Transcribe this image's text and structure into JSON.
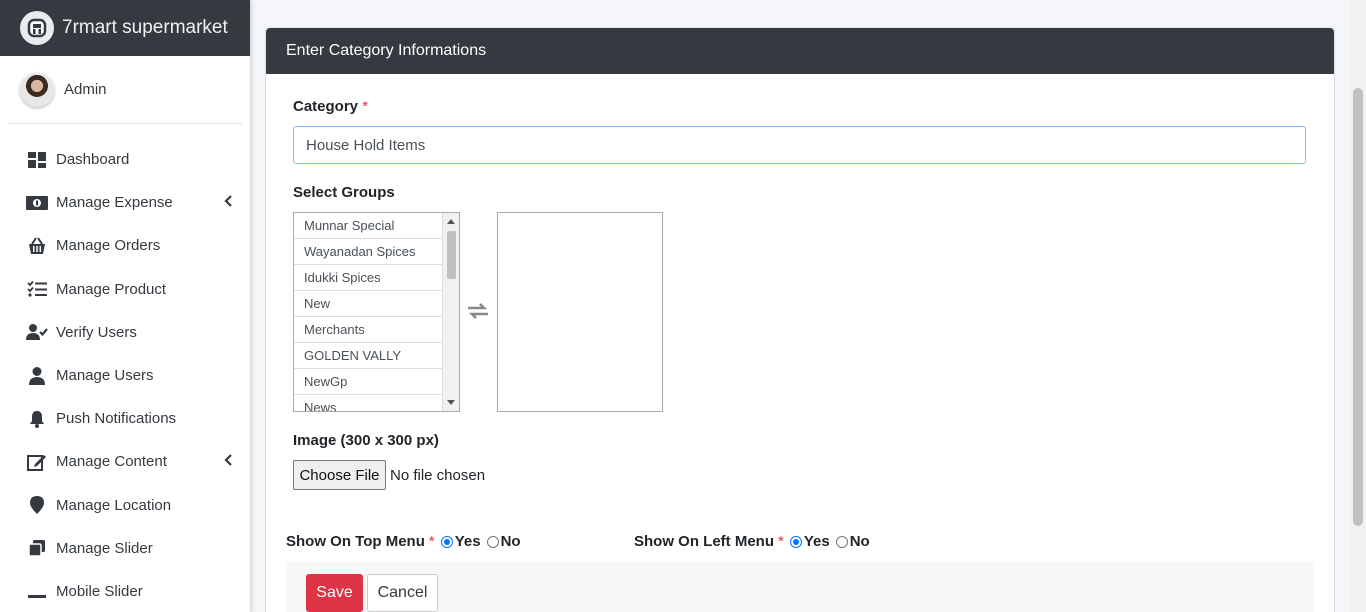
{
  "brand": {
    "name": "7rmart supermarket"
  },
  "user": {
    "name": "Admin"
  },
  "sidebar": {
    "items": [
      {
        "label": "Dashboard",
        "icon": "dashboard-icon"
      },
      {
        "label": "Manage Expense",
        "icon": "money-icon",
        "has_arrow": true
      },
      {
        "label": "Manage Orders",
        "icon": "basket-icon"
      },
      {
        "label": "Manage Product",
        "icon": "tasks-icon"
      },
      {
        "label": "Verify Users",
        "icon": "user-check-icon"
      },
      {
        "label": "Manage Users",
        "icon": "user-icon"
      },
      {
        "label": "Push Notifications",
        "icon": "bell-icon"
      },
      {
        "label": "Manage Content",
        "icon": "edit-icon",
        "has_arrow": true
      },
      {
        "label": "Manage Location",
        "icon": "map-marker-icon"
      },
      {
        "label": "Manage Slider",
        "icon": "clone-icon"
      },
      {
        "label": "Mobile Slider",
        "icon": "minus-icon"
      }
    ]
  },
  "form": {
    "header": "Enter Category Informations",
    "category_label": "Category",
    "required_mark": "*",
    "category_value": "House Hold Items",
    "groups_label": "Select Groups",
    "groups_available": [
      "Munnar Special",
      "Wayanadan Spices",
      "Idukki Spices",
      "New",
      "Merchants",
      "GOLDEN VALLY",
      "NewGp",
      "News"
    ],
    "image_label": "Image (300 x 300 px)",
    "choose_file_label": "Choose File",
    "file_status": "No file chosen",
    "top_menu": {
      "label": "Show On Top Menu",
      "yes": "Yes",
      "no": "No",
      "selected": "Yes"
    },
    "left_menu": {
      "label": "Show On Left Menu",
      "yes": "Yes",
      "no": "No",
      "selected": "Yes"
    },
    "save_label": "Save",
    "cancel_label": "Cancel"
  },
  "colors": {
    "sidebar_brand": "#343a40",
    "save": "#dc3545",
    "focus": "#80bdff",
    "radio": "#0075ff"
  }
}
